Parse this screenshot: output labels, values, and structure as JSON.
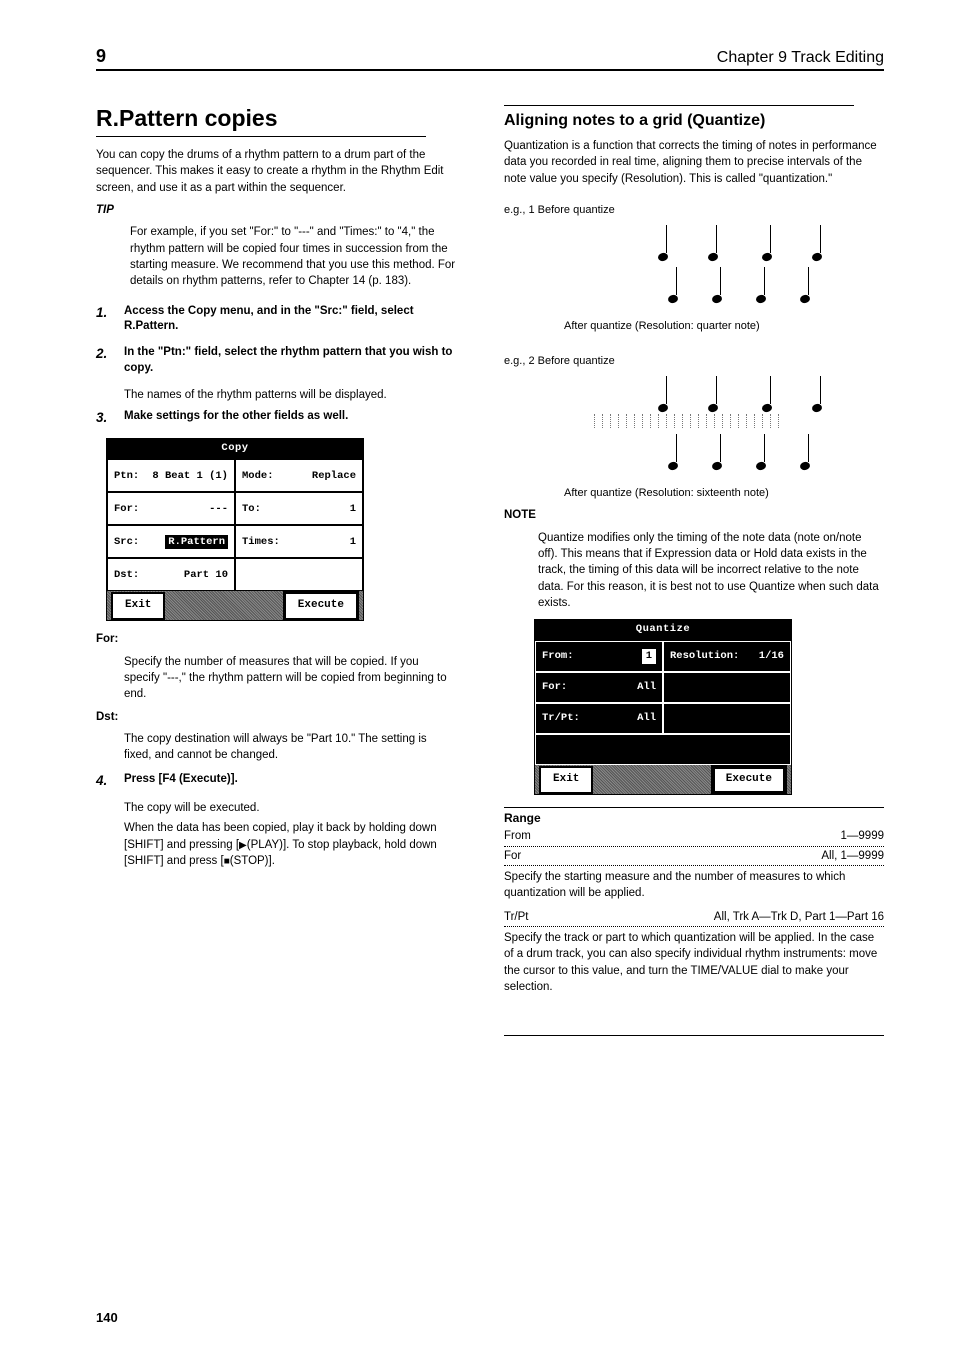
{
  "header": {
    "chapter_num": "9",
    "chapter_title": "Chapter 9  Track Editing"
  },
  "footer": {
    "page_num": "140"
  },
  "left": {
    "topic": "R.Pattern copies",
    "intro": "You can copy the drums of a rhythm pattern to a drum part of the sequencer. This makes it easy to create a rhythm in the Rhythm Edit screen, and use it as a part within the sequencer.",
    "tip_head": "TIP",
    "tip_body": "For example, if you set \"For:\" to \"---\" and \"Times:\" to \"4,\" the rhythm pattern will be copied four times in succession from the starting measure. We recommend that you use this method. For details on rhythm patterns, refer to Chapter 14 (p. 183).",
    "step1_text": "Access the Copy menu, and in the \"Src:\" field, select R.Pattern.",
    "step2_text": "In the \"Ptn:\" field, select the rhythm pattern that you wish to copy.",
    "step2_sub": "The names of the rhythm patterns will be displayed.",
    "step3_text": "Make settings for the other fields as well.",
    "copy_dlg": {
      "title": "Copy",
      "ptn_lbl": "Ptn:",
      "ptn_val": "8 Beat 1 (1)",
      "mode_lbl": "Mode:",
      "mode_val": "Replace",
      "for_lbl": "For:",
      "for_val": "---",
      "to_lbl": "To:",
      "to_val": "1",
      "src_lbl": "Src:",
      "src_val": "R.Pattern",
      "times_lbl": "Times:",
      "times_val": "1",
      "dst_lbl": "Dst:",
      "dst_val": "Part  10",
      "exit": "Exit",
      "execute": "Execute"
    },
    "sub1": {
      "label": "For:",
      "text": "Specify the number of measures that will be copied. If you specify \"---,\" the rhythm pattern will be copied from beginning to end."
    },
    "sub2": {
      "label": "Dst:",
      "text": "The copy destination will always be \"Part 10.\" The setting is fixed, and cannot be changed."
    },
    "step4_text": "Press [F4 (Execute)].",
    "step4_sub1": "The copy will be executed.",
    "step4_sub2_a": "When the data has been copied, play it back by holding down [SHIFT] and pressing [",
    "step4_sub2_b": "(PLAY)]. To stop playback, hold down [SHIFT] and press [",
    "step4_sub2_c": "(STOP)]."
  },
  "right": {
    "sec_title": "Aligning notes to a grid (Quantize)",
    "intro": "Quantization is a function that corrects the timing of notes in performance data you recorded in real time, aligning them to precise intervals of the note value you specify (Resolution). This is called \"quantization.\"",
    "ex1_label": "e.g., 1   Before quantize",
    "ex1_after": "After quantize (Resolution: quarter note)",
    "ex2_label": "e.g., 2   Before quantize",
    "ex2_after": "After quantize (Resolution: sixteenth note)",
    "note_head": "NOTE",
    "note_body": "Quantize modifies only the timing of the note data (note on/note off). This means that if Expression data or Hold data exists in the track, the timing of this data will be incorrect relative to the note data. For this reason, it is best not to use Quantize when such data exists.",
    "q_dlg": {
      "title": "Quantize",
      "from_lbl": "From:",
      "from_val": "1",
      "res_lbl": "Resolution:",
      "res_val": "1/16",
      "for_lbl": "For:",
      "for_val": "All",
      "trpt_lbl": "Tr/Pt:",
      "trpt_val": "All",
      "exit": "Exit",
      "execute": "Execute"
    },
    "range_title": "Range",
    "param_from": {
      "lbl": "From",
      "rng": "1—9999"
    },
    "param_for": {
      "lbl": "For",
      "rng": "All, 1—9999"
    },
    "param_desc12": "Specify the starting measure and the number of measures to which quantization will be applied.",
    "param_trpt": {
      "lbl": "Tr/Pt",
      "rng": "All, Trk A—Trk D, Part 1—Part 16"
    },
    "param_desc3": "Specify the track or part to which quantization will be applied. In the case of a drum track, you can also specify individual rhythm instruments: move the cursor to this value, and turn the TIME/VALUE dial to make your selection."
  }
}
